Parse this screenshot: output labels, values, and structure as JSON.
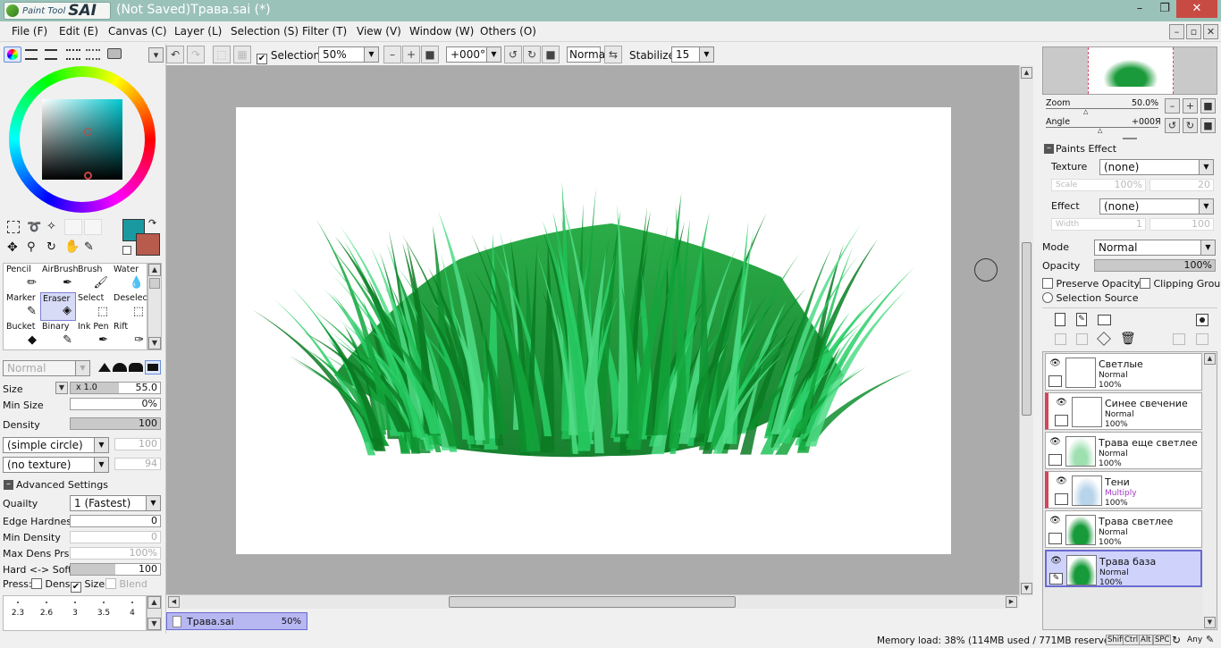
{
  "window": {
    "app_name_small": "Paint Tool",
    "app_name_big": "SAI",
    "title": "(Not Saved)Трава.sai (*)",
    "min_glyph": "–",
    "max_glyph": "❐",
    "close_glyph": "✕"
  },
  "menu": [
    "File (F)",
    "Edit (E)",
    "Canvas (C)",
    "Layer (L)",
    "Selection (S)",
    "Filter (T)",
    "View (V)",
    "Window (W)",
    "Others (O)"
  ],
  "toolbar": {
    "selection_label": "Selection",
    "selection_checked": true,
    "zoom_value": "50%",
    "angle_value": "+000°",
    "blend_value": "Normal",
    "stabilizer_label": "Stabilizer",
    "stabilizer_value": "15"
  },
  "colors": {
    "primary": "#1a9aa0",
    "secondary": "#b85a4c",
    "accent_title": "#9bc2b9"
  },
  "tools": [
    {
      "name": "Pencil",
      "icon": "pencil-icon"
    },
    {
      "name": "AirBrush",
      "icon": "airbrush-icon"
    },
    {
      "name": "Brush",
      "icon": "brush-icon"
    },
    {
      "name": "Water",
      "icon": "water-icon"
    },
    {
      "name": "Marker",
      "icon": "marker-icon"
    },
    {
      "name": "Eraser",
      "icon": "eraser-icon",
      "selected": true
    },
    {
      "name": "Select",
      "icon": "select-icon"
    },
    {
      "name": "Deselect",
      "icon": "deselect-icon"
    },
    {
      "name": "Bucket",
      "icon": "bucket-icon"
    },
    {
      "name": "Binary",
      "icon": "binary-icon"
    },
    {
      "name": "Ink Pen",
      "icon": "ink-pen-icon"
    },
    {
      "name": "Rift",
      "icon": "rift-icon"
    }
  ],
  "brush": {
    "mode_value": "Normal",
    "size_label": "Size",
    "size_mult": "x 1.0",
    "size_value": "55.0",
    "min_size_label": "Min Size",
    "min_size_value": "0%",
    "density_label": "Density",
    "density_value": "100",
    "shape_value": "(simple circle)",
    "shape_amount": "100",
    "texture_value": "(no texture)",
    "texture_amount": "94",
    "advanced_label": "Advanced Settings",
    "quality_label": "Quailty",
    "quality_value": "1 (Fastest)",
    "edge_label": "Edge Hardness",
    "edge_value": "0",
    "min_density_label": "Min Density",
    "min_density_value": "0",
    "max_dens_label": "Max Dens Prs.",
    "max_dens_value": "100%",
    "hard_soft_label": "Hard <-> Soft",
    "hard_soft_value": "100",
    "press_label": "Press:",
    "press_dens": "Dens",
    "press_size": "Size",
    "press_blend": "Blend"
  },
  "brush_sizes": [
    "2.3",
    "2.6",
    "3",
    "3.5",
    "4"
  ],
  "navigator": {
    "zoom_label": "Zoom",
    "zoom_value": "50.0%",
    "angle_label": "Angle",
    "angle_value": "+000Я"
  },
  "paints_effect": {
    "header": "Paints Effect",
    "texture_label": "Texture",
    "texture_value": "(none)",
    "scale_label": "Scale",
    "scale_value": "100%",
    "scale_num": "20",
    "effect_label": "Effect",
    "effect_value": "(none)",
    "width_label": "Width",
    "width_value": "1",
    "width_num": "100"
  },
  "layer_props": {
    "mode_label": "Mode",
    "mode_value": "Normal",
    "opacity_label": "Opacity",
    "opacity_value": "100%",
    "preserve_label": "Preserve Opacity",
    "clipping_label": "Clipping Group",
    "selection_source_label": "Selection Source"
  },
  "layers": [
    {
      "name": "Светлые",
      "mode": "Normal",
      "opacity": "100%",
      "clipped": false,
      "selected": false,
      "thumb": "blank"
    },
    {
      "name": "Синее свечение",
      "mode": "Normal",
      "opacity": "100%",
      "clipped": true,
      "selected": false,
      "thumb": "blank"
    },
    {
      "name": "Трава еще светлее",
      "mode": "Normal",
      "opacity": "100%",
      "clipped": false,
      "selected": false,
      "thumb": "light"
    },
    {
      "name": "Тени",
      "mode": "Multiply",
      "opacity": "100%",
      "clipped": true,
      "selected": false,
      "thumb": "shadow"
    },
    {
      "name": "Трава светлее",
      "mode": "Normal",
      "opacity": "100%",
      "clipped": false,
      "selected": false,
      "thumb": "grass"
    },
    {
      "name": "Трава база",
      "mode": "Normal",
      "opacity": "100%",
      "clipped": false,
      "selected": true,
      "thumb": "grass"
    }
  ],
  "doc_tab": {
    "name": "Трава.sai",
    "zoom": "50%"
  },
  "status": {
    "memory": "Memory load: 38% (114MB used / 771MB reserved)",
    "keys": [
      "Shift",
      "Ctrl",
      "Alt",
      "SPC"
    ],
    "any": "Any"
  }
}
